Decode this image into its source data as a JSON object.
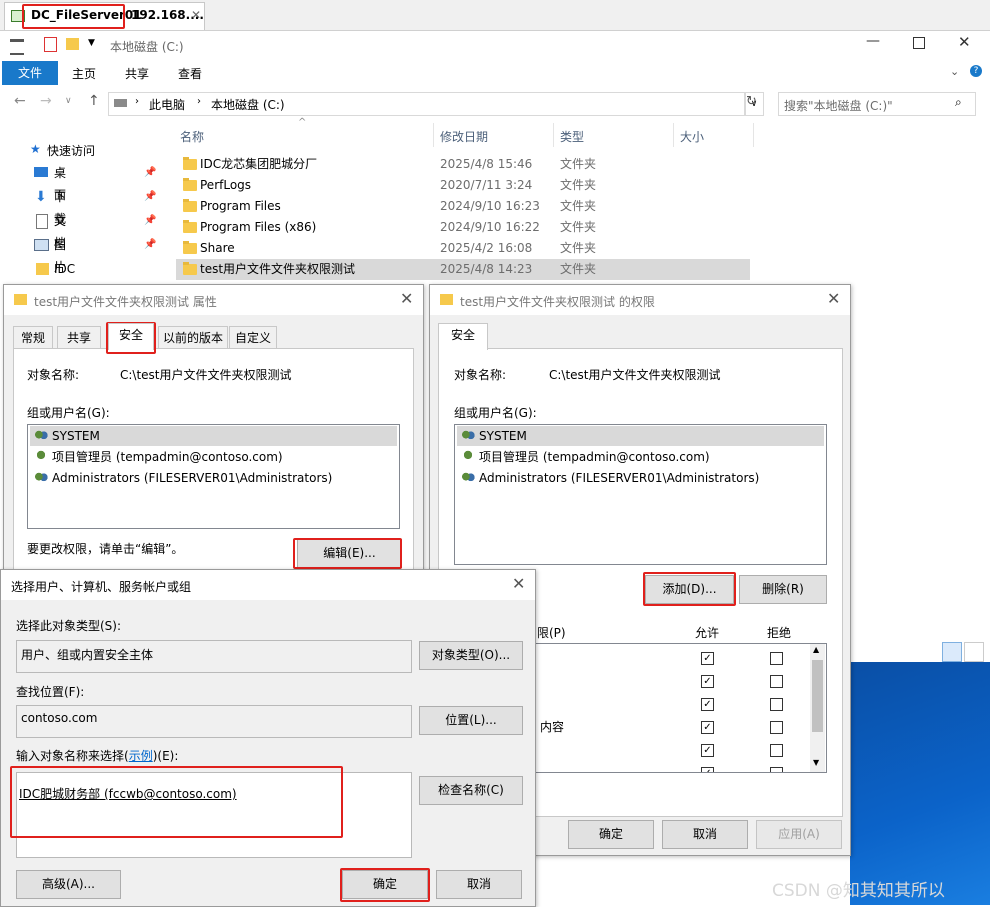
{
  "rdp_tab": {
    "title": "DC_FileServer01",
    "address": "192.168...."
  },
  "explorer": {
    "address_path": [
      "此电脑",
      "本地磁盘 (C:)"
    ],
    "window_title": "本地磁盘 (C:)",
    "ribbon_tabs": [
      "文件",
      "主页",
      "共享",
      "查看"
    ],
    "search_placeholder": "搜索\"本地磁盘 (C:)\"",
    "columns": [
      "名称",
      "修改日期",
      "类型",
      "大小"
    ],
    "nav": {
      "quick_access": "快速访问",
      "items": [
        "桌面",
        "下载",
        "文档",
        "图片",
        "IDC财务部用户文件"
      ]
    },
    "files": [
      {
        "name": "IDC龙芯集团肥城分厂",
        "date": "2025/4/8 15:46",
        "type": "文件夹"
      },
      {
        "name": "PerfLogs",
        "date": "2020/7/11 3:24",
        "type": "文件夹"
      },
      {
        "name": "Program Files",
        "date": "2024/9/10 16:23",
        "type": "文件夹"
      },
      {
        "name": "Program Files (x86)",
        "date": "2024/9/10 16:22",
        "type": "文件夹"
      },
      {
        "name": "Share",
        "date": "2025/4/2 16:08",
        "type": "文件夹"
      },
      {
        "name": "test用户文件文件夹权限测试",
        "date": "2025/4/8 14:23",
        "type": "文件夹"
      }
    ]
  },
  "properties_dialog": {
    "title": "test用户文件文件夹权限测试 属性",
    "tabs": [
      "常规",
      "共享",
      "安全",
      "以前的版本",
      "自定义"
    ],
    "object_label": "对象名称:",
    "object_value": "C:\\test用户文件文件夹权限测试",
    "group_label": "组或用户名(G):",
    "users": [
      "SYSTEM",
      "项目管理员 (tempadmin@contoso.com)",
      "Administrators (FILESERVER01\\Administrators)"
    ],
    "edit_hint": "要更改权限，请单击“编辑”。",
    "edit_button": "编辑(E)..."
  },
  "permissions_dialog": {
    "title": "test用户文件文件夹权限测试 的权限",
    "tab": "安全",
    "object_label": "对象名称:",
    "object_value": "C:\\test用户文件文件夹权限测试",
    "group_label": "组或用户名(G):",
    "users": [
      "SYSTEM",
      "项目管理员 (tempadmin@contoso.com)",
      "Administrators (FILESERVER01\\Administrators)"
    ],
    "add_button": "添加(D)...",
    "remove_button": "删除(R)",
    "perm_header_partial": "限(P)",
    "allow_header": "允许",
    "deny_header": "拒绝",
    "perm_partial_label": "内容",
    "allow_checks": [
      true,
      true,
      true,
      true,
      true,
      true
    ],
    "deny_checks": [
      false,
      false,
      false,
      false,
      false,
      false
    ],
    "ok": "确定",
    "cancel": "取消",
    "apply": "应用(A)"
  },
  "select_dialog": {
    "title": "选择用户、计算机、服务帐户或组",
    "object_type_label": "选择此对象类型(S):",
    "object_type_value": "用户、组或内置安全主体",
    "object_type_button": "对象类型(O)...",
    "location_label": "查找位置(F):",
    "location_value": "contoso.com",
    "location_button": "位置(L)...",
    "enter_label_pre": "输入对象名称来选择(",
    "enter_label_link": "示例",
    "enter_label_post": ")(E):",
    "enter_value": "IDC肥城财务部 (fccwb@contoso.com)",
    "check_button": "检查名称(C)",
    "advanced_button": "高级(A)...",
    "ok": "确定",
    "cancel": "取消"
  },
  "watermark": "CSDN @知其知其所以"
}
